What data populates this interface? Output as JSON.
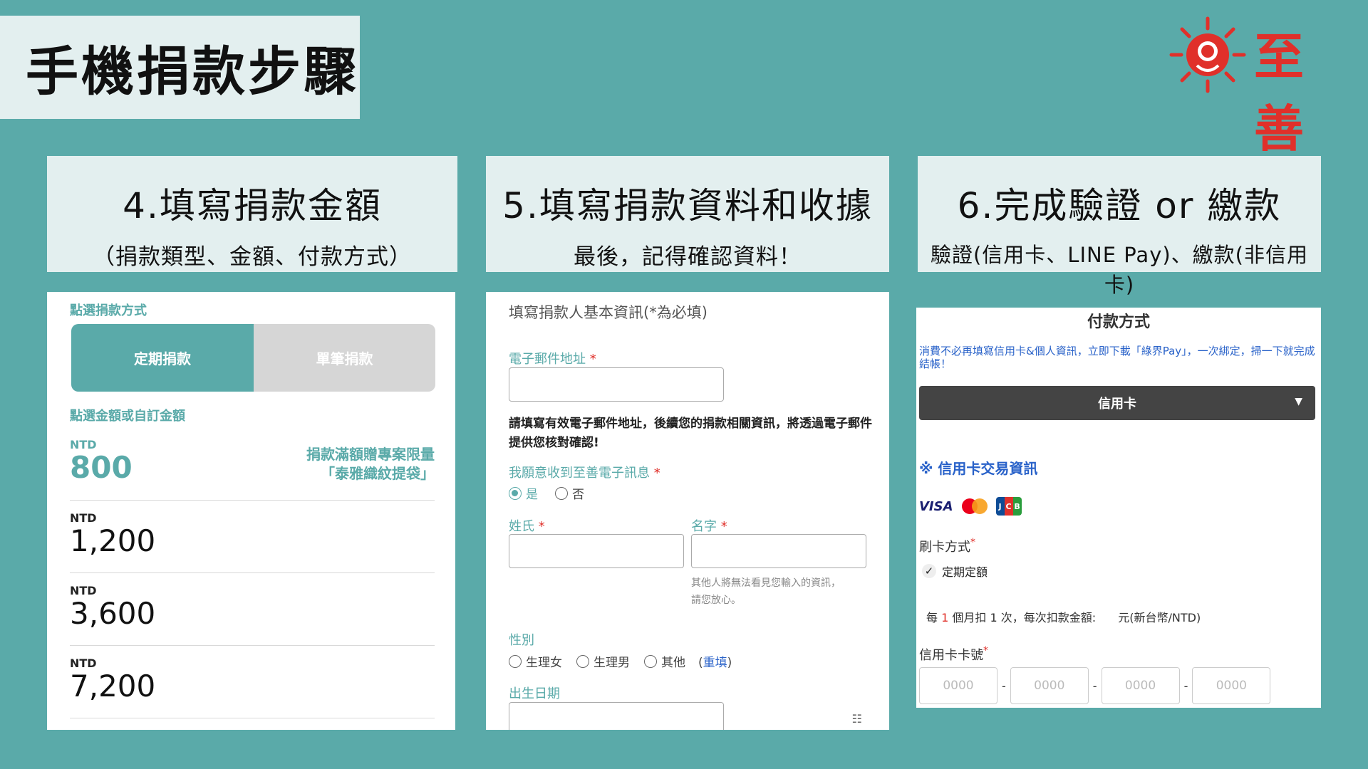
{
  "page_title": "手機捐款步驟",
  "logo": {
    "text": "至善",
    "color": "#e0302a"
  },
  "steps": [
    {
      "title": "4.填寫捐款金額",
      "subtitle": "（捐款類型、金額、付款方式）"
    },
    {
      "title": "5.填寫捐款資料和收據",
      "subtitle": "最後，記得確認資料！"
    },
    {
      "title": "6.完成驗證 or 繳款",
      "subtitle": "驗證(信用卡、LINE Pay)、繳款(非信用卡)"
    }
  ],
  "panel1": {
    "method_label": "點選捐款方式",
    "tab_recurring": "定期捐款",
    "tab_single": "單筆捐款",
    "amount_label": "點選金額或自訂金額",
    "amounts": [
      {
        "currency": "NTD",
        "value": "800"
      },
      {
        "currency": "NTD",
        "value": "1,200"
      },
      {
        "currency": "NTD",
        "value": "3,600"
      },
      {
        "currency": "NTD",
        "value": "7,200"
      }
    ],
    "gift_line1": "捐款滿額贈專案限量",
    "gift_line2": "「泰雅織紋提袋」"
  },
  "panel2": {
    "section_title": "填寫捐款人基本資訊(*為必填)",
    "email_label": "電子郵件地址",
    "required_mark": "*",
    "email_note": "請填寫有效電子郵件地址，後續您的捐款相關資訊，將透過電子郵件提供您核對確認!",
    "newsletter_label": "我願意收到至善電子訊息",
    "yes": "是",
    "no": "否",
    "surname_label": "姓氏",
    "given_label": "名字",
    "privacy_hint_1": "其他人將無法看見您輸入的資訊，",
    "privacy_hint_2": "請您放心。",
    "gender_label": "性別",
    "gender_options": [
      "生理女",
      "生理男",
      "其他"
    ],
    "gender_fill_open": "(",
    "gender_fill_link": "重填",
    "gender_fill_close": ")",
    "birthday_label": "出生日期"
  },
  "panel3": {
    "title": "付款方式",
    "promo": "消費不必再填寫信用卡&個人資訊，立即下載「綠界Pay」，一次綁定，掃一下就完成結帳！",
    "payment_select": "信用卡",
    "cc_info": "※ 信用卡交易資訊",
    "card_brands": [
      "VISA",
      "MasterCard",
      "JCB"
    ],
    "swipe_label": "刷卡方式",
    "swipe_option": "定期定額",
    "cycle_prefix": "每",
    "cycle_months": "1",
    "cycle_mid": "個月扣",
    "cycle_times": "1",
    "cycle_suffix": "次，每次扣款金額:",
    "cycle_unit": "元(新台幣/NTD)",
    "card_number_label": "信用卡卡號",
    "card_number_placeholder": "0000"
  }
}
